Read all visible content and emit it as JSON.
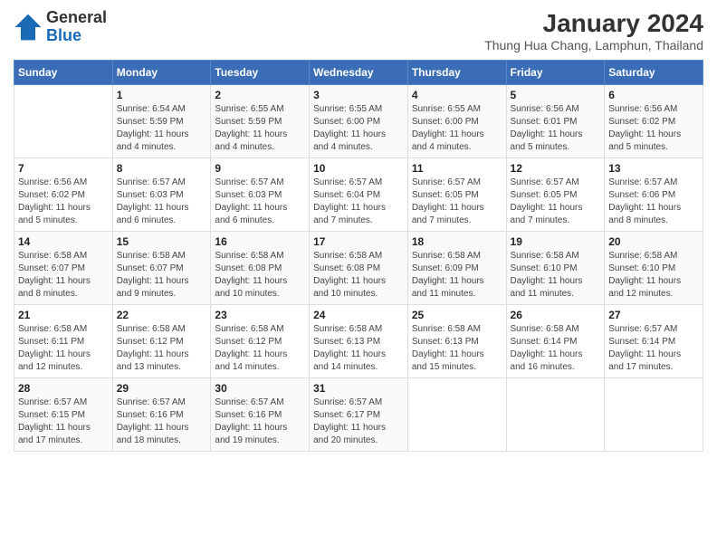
{
  "header": {
    "logo_general": "General",
    "logo_blue": "Blue",
    "title": "January 2024",
    "subtitle": "Thung Hua Chang, Lamphun, Thailand"
  },
  "days_of_week": [
    "Sunday",
    "Monday",
    "Tuesday",
    "Wednesday",
    "Thursday",
    "Friday",
    "Saturday"
  ],
  "weeks": [
    [
      {
        "num": "",
        "info": ""
      },
      {
        "num": "1",
        "info": "Sunrise: 6:54 AM\nSunset: 5:59 PM\nDaylight: 11 hours\nand 4 minutes."
      },
      {
        "num": "2",
        "info": "Sunrise: 6:55 AM\nSunset: 5:59 PM\nDaylight: 11 hours\nand 4 minutes."
      },
      {
        "num": "3",
        "info": "Sunrise: 6:55 AM\nSunset: 6:00 PM\nDaylight: 11 hours\nand 4 minutes."
      },
      {
        "num": "4",
        "info": "Sunrise: 6:55 AM\nSunset: 6:00 PM\nDaylight: 11 hours\nand 4 minutes."
      },
      {
        "num": "5",
        "info": "Sunrise: 6:56 AM\nSunset: 6:01 PM\nDaylight: 11 hours\nand 5 minutes."
      },
      {
        "num": "6",
        "info": "Sunrise: 6:56 AM\nSunset: 6:02 PM\nDaylight: 11 hours\nand 5 minutes."
      }
    ],
    [
      {
        "num": "7",
        "info": "Sunrise: 6:56 AM\nSunset: 6:02 PM\nDaylight: 11 hours\nand 5 minutes."
      },
      {
        "num": "8",
        "info": "Sunrise: 6:57 AM\nSunset: 6:03 PM\nDaylight: 11 hours\nand 6 minutes."
      },
      {
        "num": "9",
        "info": "Sunrise: 6:57 AM\nSunset: 6:03 PM\nDaylight: 11 hours\nand 6 minutes."
      },
      {
        "num": "10",
        "info": "Sunrise: 6:57 AM\nSunset: 6:04 PM\nDaylight: 11 hours\nand 7 minutes."
      },
      {
        "num": "11",
        "info": "Sunrise: 6:57 AM\nSunset: 6:05 PM\nDaylight: 11 hours\nand 7 minutes."
      },
      {
        "num": "12",
        "info": "Sunrise: 6:57 AM\nSunset: 6:05 PM\nDaylight: 11 hours\nand 7 minutes."
      },
      {
        "num": "13",
        "info": "Sunrise: 6:57 AM\nSunset: 6:06 PM\nDaylight: 11 hours\nand 8 minutes."
      }
    ],
    [
      {
        "num": "14",
        "info": "Sunrise: 6:58 AM\nSunset: 6:07 PM\nDaylight: 11 hours\nand 8 minutes."
      },
      {
        "num": "15",
        "info": "Sunrise: 6:58 AM\nSunset: 6:07 PM\nDaylight: 11 hours\nand 9 minutes."
      },
      {
        "num": "16",
        "info": "Sunrise: 6:58 AM\nSunset: 6:08 PM\nDaylight: 11 hours\nand 10 minutes."
      },
      {
        "num": "17",
        "info": "Sunrise: 6:58 AM\nSunset: 6:08 PM\nDaylight: 11 hours\nand 10 minutes."
      },
      {
        "num": "18",
        "info": "Sunrise: 6:58 AM\nSunset: 6:09 PM\nDaylight: 11 hours\nand 11 minutes."
      },
      {
        "num": "19",
        "info": "Sunrise: 6:58 AM\nSunset: 6:10 PM\nDaylight: 11 hours\nand 11 minutes."
      },
      {
        "num": "20",
        "info": "Sunrise: 6:58 AM\nSunset: 6:10 PM\nDaylight: 11 hours\nand 12 minutes."
      }
    ],
    [
      {
        "num": "21",
        "info": "Sunrise: 6:58 AM\nSunset: 6:11 PM\nDaylight: 11 hours\nand 12 minutes."
      },
      {
        "num": "22",
        "info": "Sunrise: 6:58 AM\nSunset: 6:12 PM\nDaylight: 11 hours\nand 13 minutes."
      },
      {
        "num": "23",
        "info": "Sunrise: 6:58 AM\nSunset: 6:12 PM\nDaylight: 11 hours\nand 14 minutes."
      },
      {
        "num": "24",
        "info": "Sunrise: 6:58 AM\nSunset: 6:13 PM\nDaylight: 11 hours\nand 14 minutes."
      },
      {
        "num": "25",
        "info": "Sunrise: 6:58 AM\nSunset: 6:13 PM\nDaylight: 11 hours\nand 15 minutes."
      },
      {
        "num": "26",
        "info": "Sunrise: 6:58 AM\nSunset: 6:14 PM\nDaylight: 11 hours\nand 16 minutes."
      },
      {
        "num": "27",
        "info": "Sunrise: 6:57 AM\nSunset: 6:14 PM\nDaylight: 11 hours\nand 17 minutes."
      }
    ],
    [
      {
        "num": "28",
        "info": "Sunrise: 6:57 AM\nSunset: 6:15 PM\nDaylight: 11 hours\nand 17 minutes."
      },
      {
        "num": "29",
        "info": "Sunrise: 6:57 AM\nSunset: 6:16 PM\nDaylight: 11 hours\nand 18 minutes."
      },
      {
        "num": "30",
        "info": "Sunrise: 6:57 AM\nSunset: 6:16 PM\nDaylight: 11 hours\nand 19 minutes."
      },
      {
        "num": "31",
        "info": "Sunrise: 6:57 AM\nSunset: 6:17 PM\nDaylight: 11 hours\nand 20 minutes."
      },
      {
        "num": "",
        "info": ""
      },
      {
        "num": "",
        "info": ""
      },
      {
        "num": "",
        "info": ""
      }
    ]
  ]
}
